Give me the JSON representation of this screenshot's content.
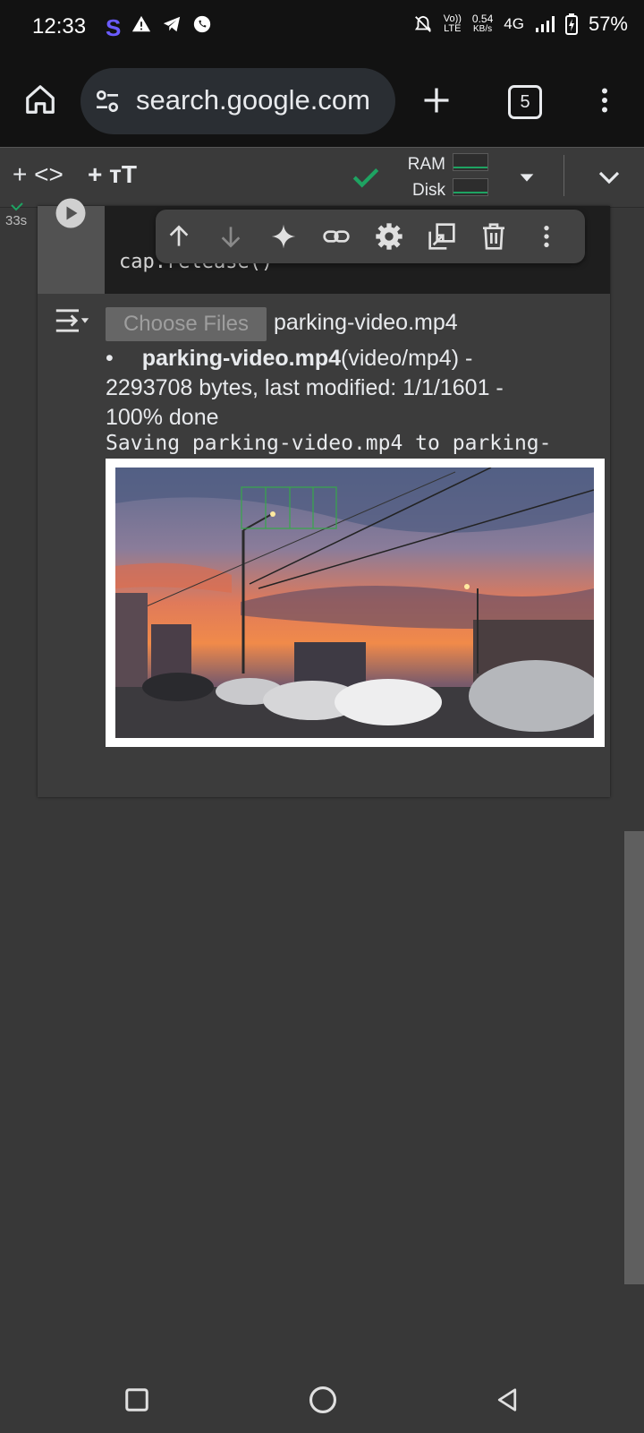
{
  "status_bar": {
    "time": "12:33",
    "net_speed_value": "0.54",
    "net_speed_unit": "KB/s",
    "volte_top": "Vo))",
    "volte_bottom": "LTE",
    "network": "4G",
    "battery": "57%"
  },
  "browser": {
    "url": "search.google.com",
    "tab_count": "5"
  },
  "toolbar": {
    "add_code": "+ <>",
    "add_text": "+ тT",
    "ram_label": "RAM",
    "disk_label": "Disk"
  },
  "cell": {
    "exec_time": "33s",
    "code_line": "cap.release()"
  },
  "output": {
    "choose_files": "Choose Files",
    "file_name": "parking-video.mp4",
    "item_name": "parking-video.mp4",
    "item_type": "(video/mp4) -",
    "item_details": "2293708 bytes, last modified: 1/1/1601 -",
    "item_progress": "100% done",
    "saving_line": "Saving parking-video.mp4 to parking-"
  },
  "colors": {
    "accent_green": "#1ea362",
    "background": "#383838",
    "code_bg": "#1e1e1e"
  }
}
